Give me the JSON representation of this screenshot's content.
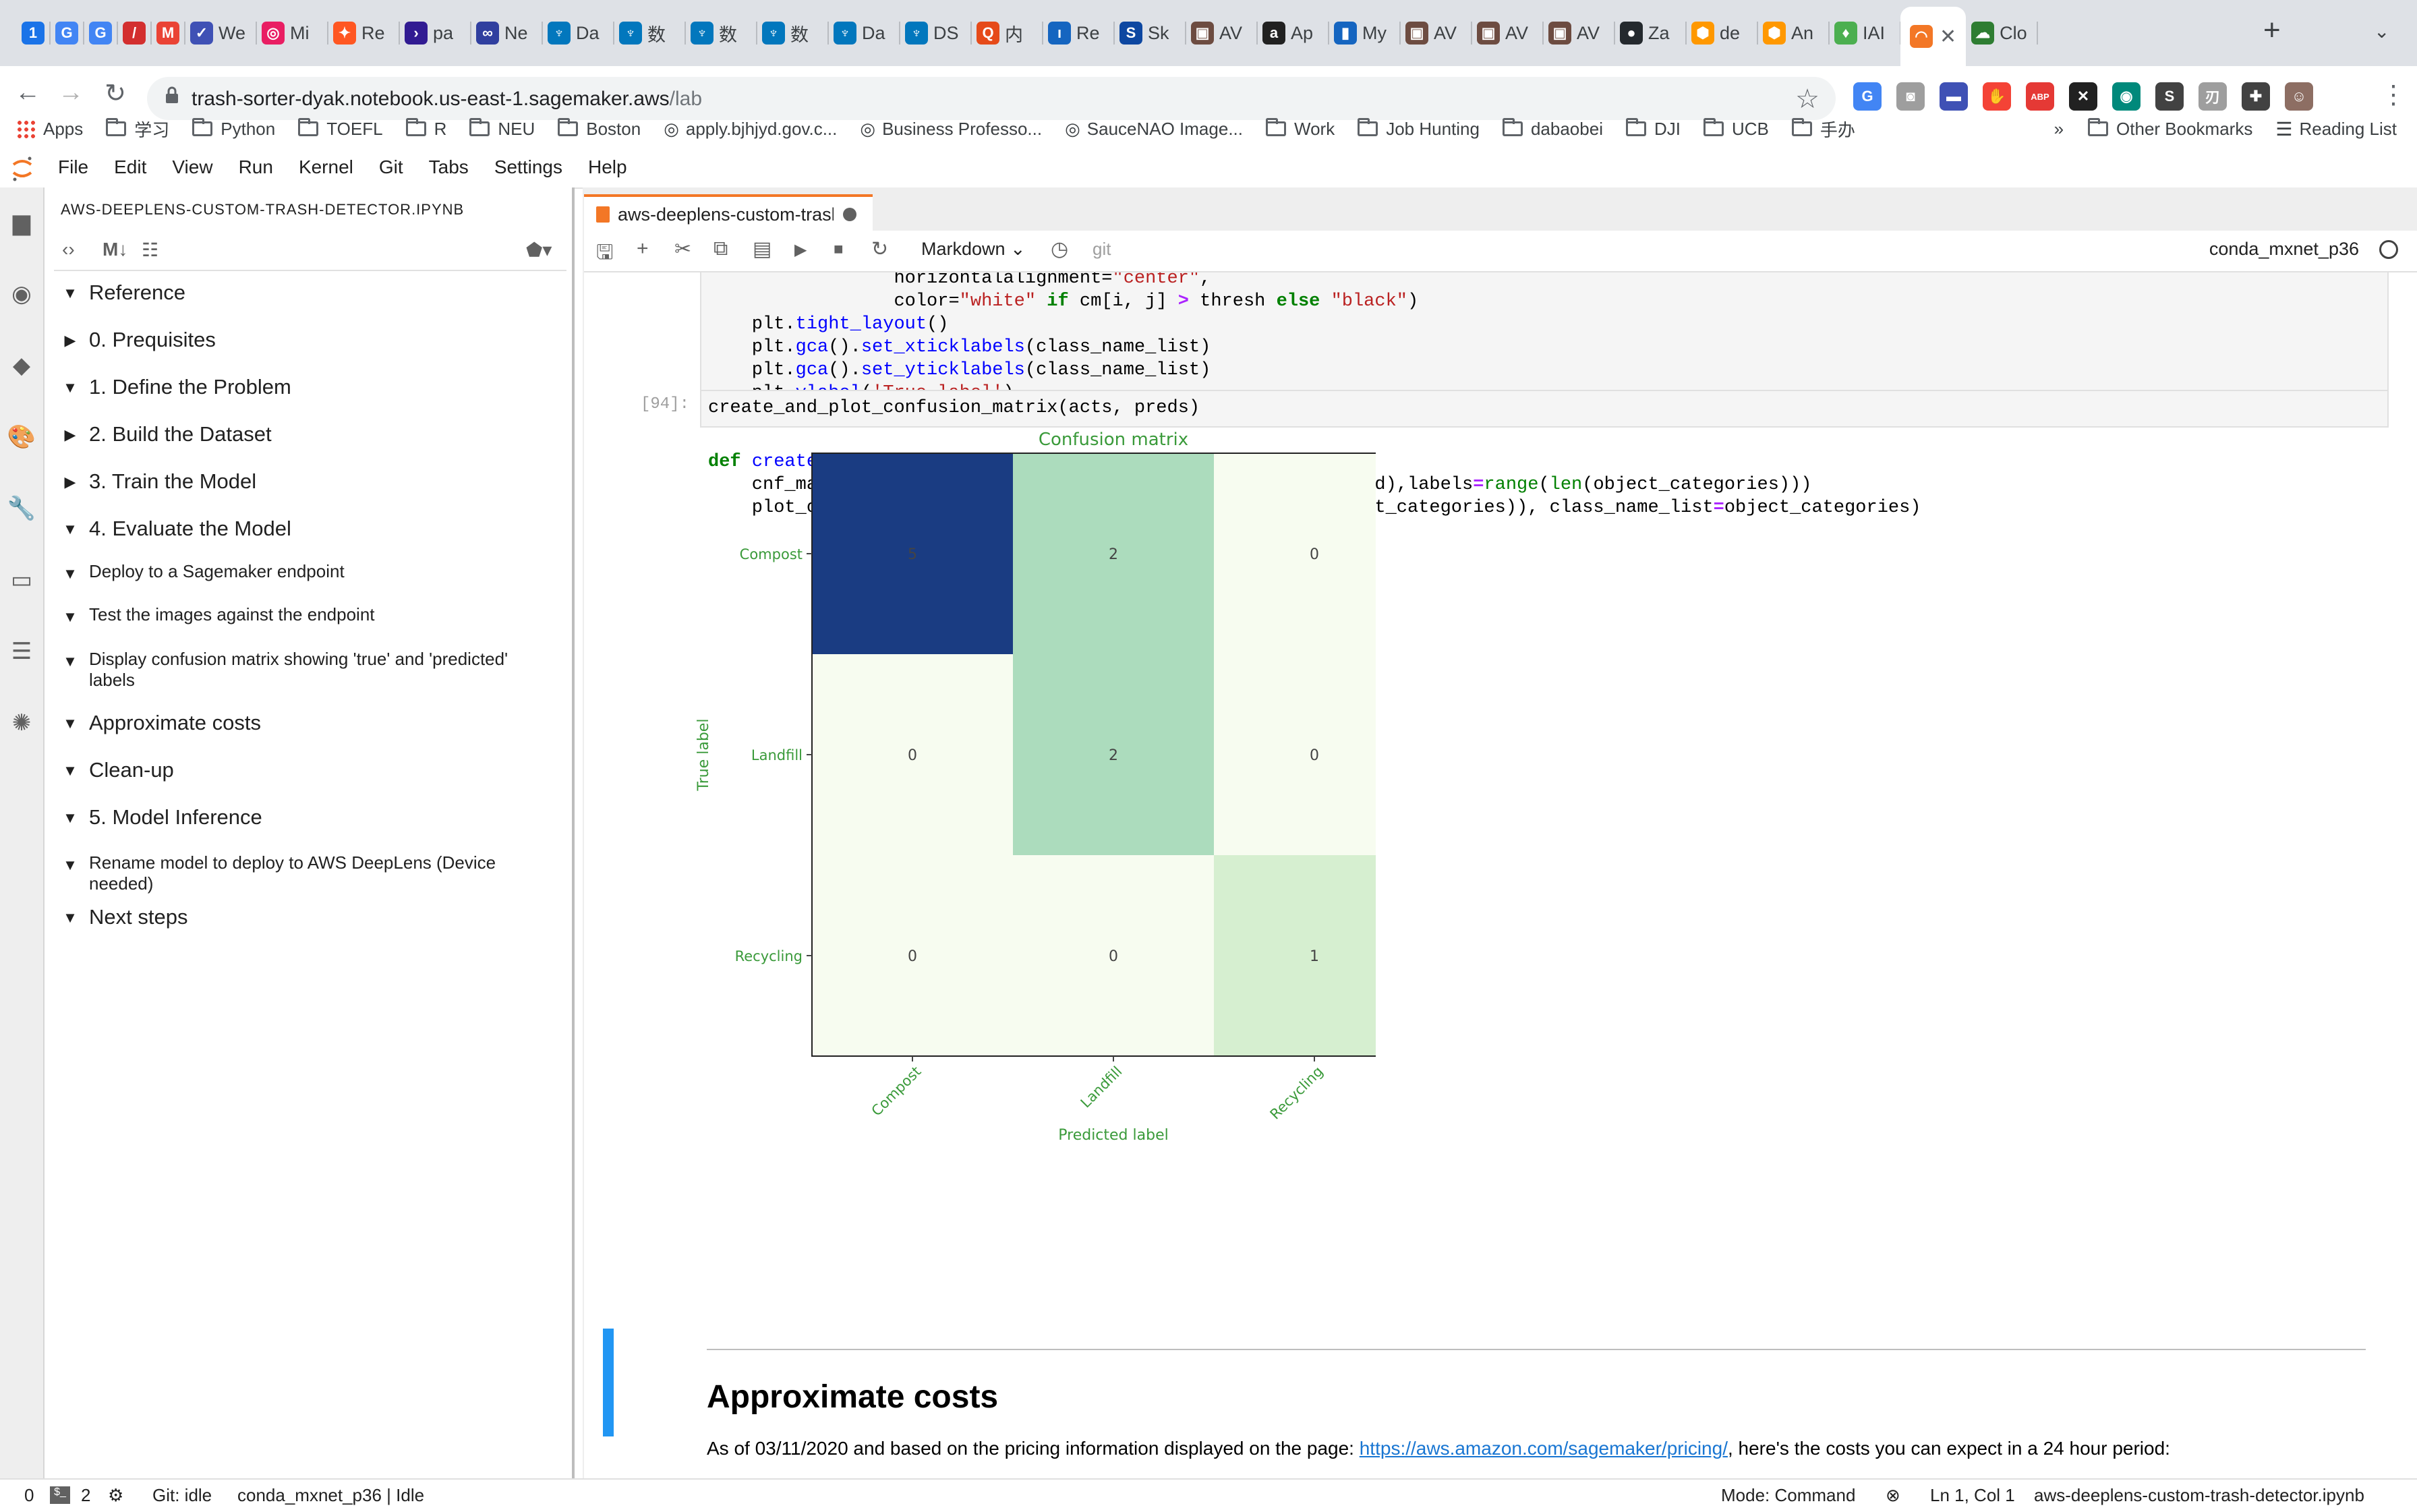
{
  "browser": {
    "tabs": [
      {
        "title": "",
        "color": "#1a73e8",
        "glyph": "1"
      },
      {
        "title": "",
        "color": "#4285f4",
        "glyph": "G"
      },
      {
        "title": "",
        "color": "#4285f4",
        "glyph": "G"
      },
      {
        "title": "",
        "color": "#d32f2f",
        "glyph": "/"
      },
      {
        "title": "",
        "color": "#ea4335",
        "glyph": "M"
      },
      {
        "title": "We",
        "color": "#3f51b5",
        "glyph": "✓"
      },
      {
        "title": "Mi",
        "color": "#e91e63",
        "glyph": "◎"
      },
      {
        "title": "Re",
        "color": "#ff5722",
        "glyph": "✦"
      },
      {
        "title": "pa",
        "color": "#311b92",
        "glyph": "›"
      },
      {
        "title": "Ne",
        "color": "#303f9f",
        "glyph": "∞"
      },
      {
        "title": "Da",
        "color": "#0277bd",
        "glyph": "♆"
      },
      {
        "title": "数",
        "color": "#0277bd",
        "glyph": "♆"
      },
      {
        "title": "数",
        "color": "#0277bd",
        "glyph": "♆"
      },
      {
        "title": "数",
        "color": "#0277bd",
        "glyph": "♆"
      },
      {
        "title": "Da",
        "color": "#0277bd",
        "glyph": "♆"
      },
      {
        "title": "DS",
        "color": "#0277bd",
        "glyph": "♆"
      },
      {
        "title": "内",
        "color": "#e64a19",
        "glyph": "Q"
      },
      {
        "title": "Re",
        "color": "#1565c0",
        "glyph": "ı"
      },
      {
        "title": "Sk",
        "color": "#0d47a1",
        "glyph": "S"
      },
      {
        "title": "AV",
        "color": "#6d4c41",
        "glyph": "▣"
      },
      {
        "title": "Ap",
        "color": "#212121",
        "glyph": "a"
      },
      {
        "title": "My",
        "color": "#1565c0",
        "glyph": "▮"
      },
      {
        "title": "AV",
        "color": "#6d4c41",
        "glyph": "▣"
      },
      {
        "title": "AV",
        "color": "#6d4c41",
        "glyph": "▣"
      },
      {
        "title": "AV",
        "color": "#6d4c41",
        "glyph": "▣"
      },
      {
        "title": "Za",
        "color": "#24292e",
        "glyph": "●"
      },
      {
        "title": "de",
        "color": "#ff9800",
        "glyph": "⬢"
      },
      {
        "title": "An",
        "color": "#ff9800",
        "glyph": "⬢"
      },
      {
        "title": "IAI",
        "color": "#4caf50",
        "glyph": "♦"
      },
      {
        "title": "",
        "color": "#f37726",
        "glyph": "◠",
        "active": true
      },
      {
        "title": "Clo",
        "color": "#2e7d32",
        "glyph": "☁"
      }
    ],
    "url_host": "trash-sorter-dyak.notebook.us-east-1.sagemaker.aws",
    "url_path": "/lab",
    "extensions": [
      {
        "color": "#4285f4",
        "glyph": "G"
      },
      {
        "color": "#9e9e9e",
        "glyph": "◙"
      },
      {
        "color": "#3f51b5",
        "glyph": "▬"
      },
      {
        "color": "#f44336",
        "glyph": "✋"
      },
      {
        "color": "#e53935",
        "glyph": "ABP"
      },
      {
        "color": "#212121",
        "glyph": "✕"
      },
      {
        "color": "#00897b",
        "glyph": "◉"
      },
      {
        "color": "#424242",
        "glyph": "S"
      },
      {
        "color": "#9e9e9e",
        "glyph": "刃"
      },
      {
        "color": "#424242",
        "glyph": "✚"
      },
      {
        "color": "#8d6e63",
        "glyph": "☺"
      }
    ],
    "bookmarks": [
      {
        "label": "Apps",
        "kind": "apps"
      },
      {
        "label": "学习",
        "kind": "folder"
      },
      {
        "label": "Python",
        "kind": "folder"
      },
      {
        "label": "TOEFL",
        "kind": "folder"
      },
      {
        "label": "R",
        "kind": "folder"
      },
      {
        "label": "NEU",
        "kind": "folder"
      },
      {
        "label": "Boston",
        "kind": "folder"
      },
      {
        "label": "apply.bjhjyd.gov.c...",
        "kind": "site"
      },
      {
        "label": "Business Professo...",
        "kind": "site"
      },
      {
        "label": "SauceNAO Image...",
        "kind": "site"
      },
      {
        "label": "Work",
        "kind": "folder"
      },
      {
        "label": "Job Hunting",
        "kind": "folder"
      },
      {
        "label": "dabaobei",
        "kind": "folder"
      },
      {
        "label": "DJI",
        "kind": "folder"
      },
      {
        "label": "UCB",
        "kind": "folder"
      },
      {
        "label": "手办",
        "kind": "folder"
      }
    ],
    "bookmarks_overflow": "»",
    "other_bookmarks": "Other Bookmarks",
    "reading_list": "Reading List"
  },
  "menu": [
    "File",
    "Edit",
    "View",
    "Run",
    "Kernel",
    "Git",
    "Tabs",
    "Settings",
    "Help"
  ],
  "toc": {
    "title": "AWS-DEEPLENS-CUSTOM-TRASH-DETECTOR.IPYNB",
    "items": [
      {
        "label": "Reference",
        "level": 1,
        "expanded": true
      },
      {
        "label": "0. Prequisites",
        "level": 1,
        "expanded": false
      },
      {
        "label": "1. Define the Problem",
        "level": 1,
        "expanded": true
      },
      {
        "label": "2. Build the Dataset",
        "level": 1,
        "expanded": false
      },
      {
        "label": "3. Train the Model",
        "level": 1,
        "expanded": false
      },
      {
        "label": "4. Evaluate the Model",
        "level": 1,
        "expanded": true
      },
      {
        "label": "Deploy to a Sagemaker endpoint",
        "level": 2,
        "expanded": true
      },
      {
        "label": "Test the images against the endpoint",
        "level": 2,
        "expanded": true
      },
      {
        "label": "Display confusion matrix showing 'true' and 'predicted' labels",
        "level": 2,
        "expanded": true
      },
      {
        "label": "Approximate costs",
        "level": 1,
        "expanded": true
      },
      {
        "label": "Clean-up",
        "level": 1,
        "expanded": true
      },
      {
        "label": "5. Model Inference",
        "level": 1,
        "expanded": true
      },
      {
        "label": "Rename model to deploy to AWS DeepLens (Device needed)",
        "level": 2,
        "expanded": true
      },
      {
        "label": "Next steps",
        "level": 1,
        "expanded": true
      }
    ]
  },
  "notebook": {
    "tab_title": "aws-deeplens-custom-trash-detector.ipynb",
    "cell_type": "Markdown",
    "git_label": "git",
    "kernel": "conda_mxnet_p36",
    "prompt": "[94]:",
    "code_cell_2": "create_and_plot_confusion_matrix(acts, preds)",
    "md_heading": "Approximate costs",
    "md_text_before": "As of 03/11/2020 and based on the pricing information displayed on the page: ",
    "md_link": "https://aws.amazon.com/sagemaker/pricing/",
    "md_text_after": ", here's the costs you can expect in a 24 hour period:"
  },
  "chart_data": {
    "type": "heatmap",
    "title": "Confusion matrix",
    "xlabel": "Predicted label",
    "ylabel": "True label",
    "x_categories": [
      "Compost",
      "Landfill",
      "Recycling"
    ],
    "y_categories": [
      "Compost",
      "Landfill",
      "Recycling"
    ],
    "matrix": [
      [
        5,
        2,
        0
      ],
      [
        0,
        2,
        0
      ],
      [
        0,
        0,
        1
      ]
    ],
    "colormap": "Greens/Blues",
    "cell_colors": [
      [
        "#1a3c82",
        "#acdcbd",
        "#f7fcf0"
      ],
      [
        "#f7fcf0",
        "#acdcbd",
        "#f7fcf0"
      ],
      [
        "#f7fcf0",
        "#f7fcf0",
        "#d6efd0"
      ]
    ],
    "text_color": "#444444",
    "label_color": "#3a9a3a"
  },
  "statusbar": {
    "num_a": "0",
    "num_b": "2",
    "git": "Git: idle",
    "kernel_status": "conda_mxnet_p36 | Idle",
    "mode": "Mode: Command",
    "position": "Ln 1, Col 1",
    "filename": "aws-deeplens-custom-trash-detector.ipynb"
  },
  "colors": {
    "jupyter_orange": "#f37726",
    "link_blue": "#1976d2",
    "collapser_blue": "#2196f3"
  }
}
